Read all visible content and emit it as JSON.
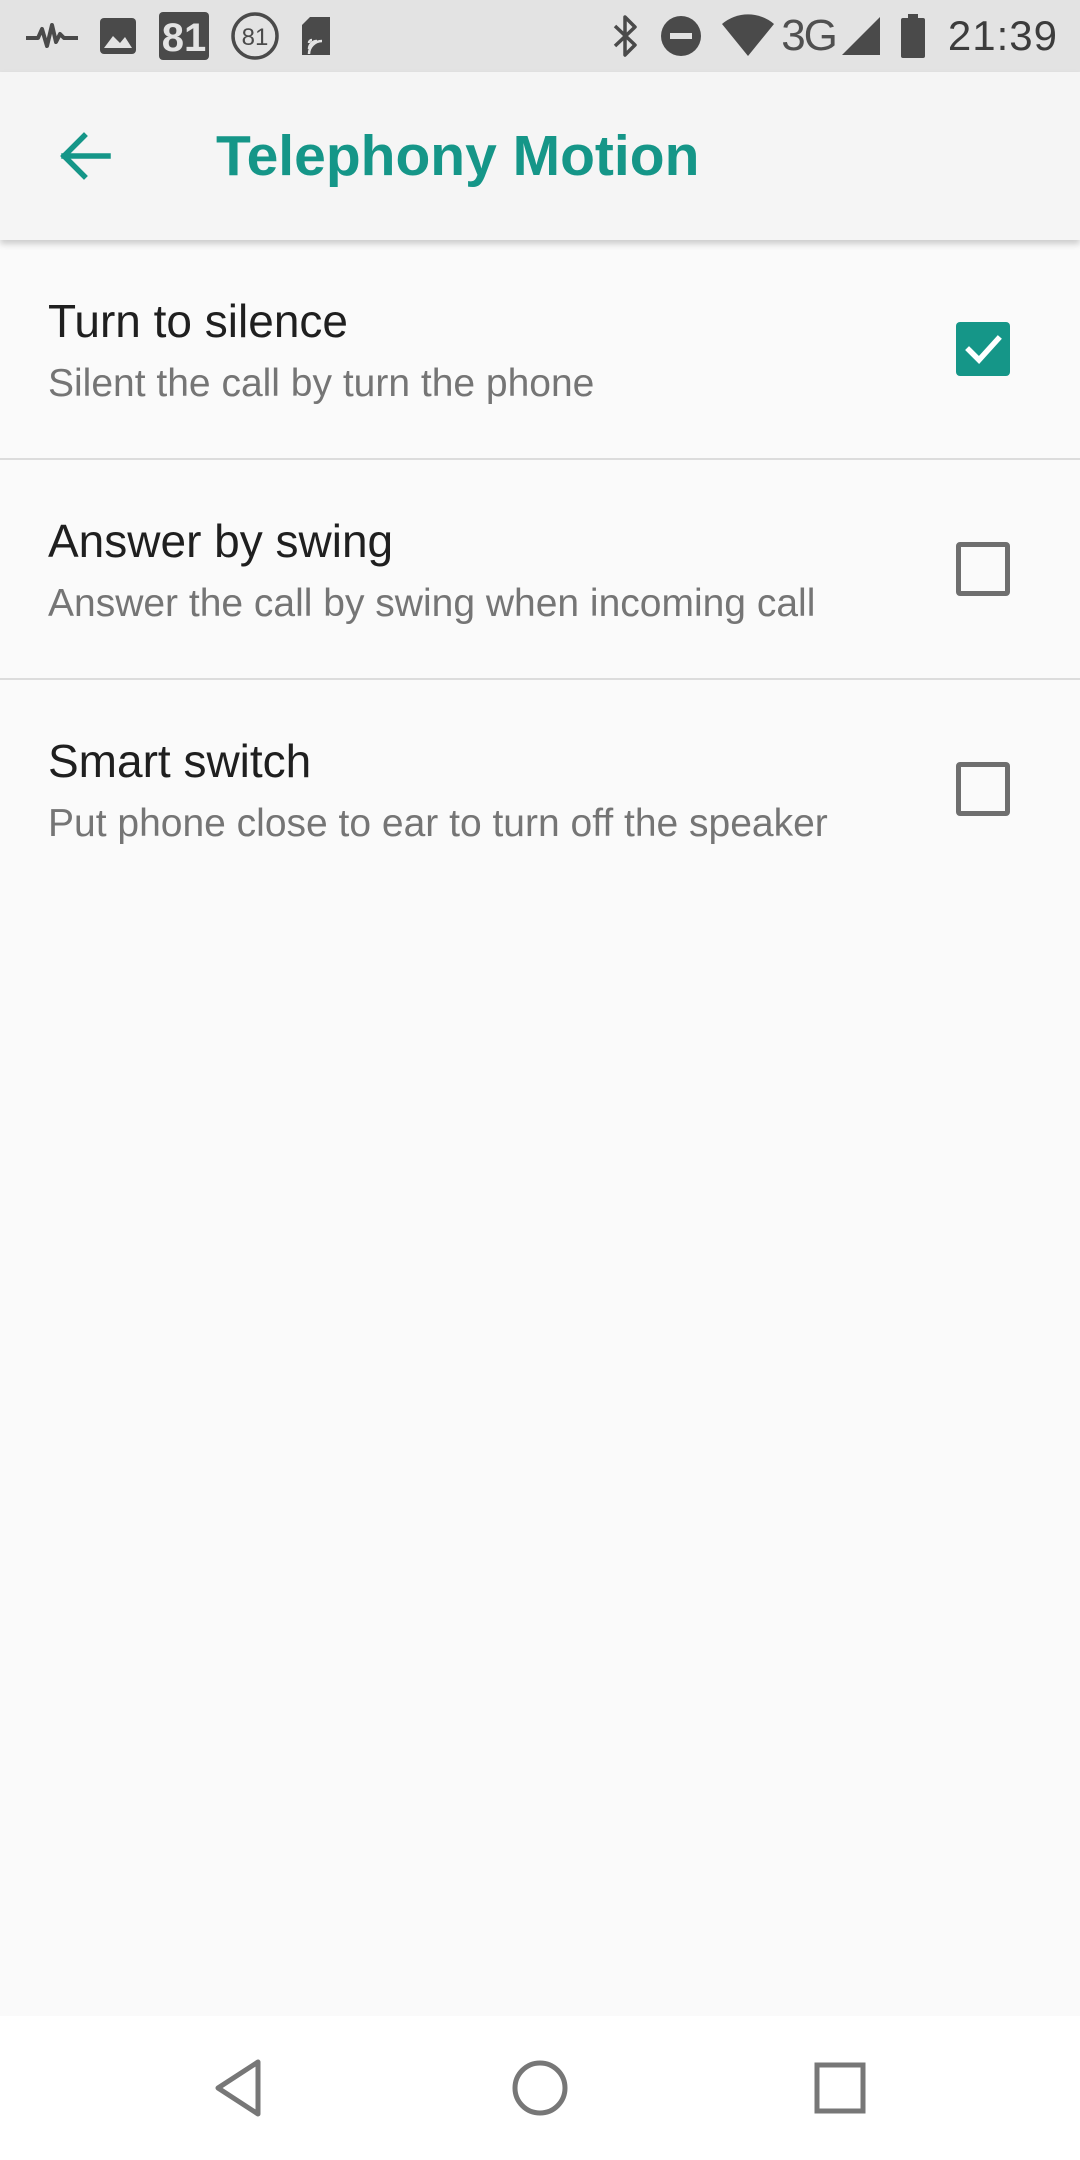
{
  "status_bar": {
    "notification_number": "81",
    "circled_number": "81",
    "network_type": "3G",
    "time": "21:39",
    "icons": [
      "activity-icon",
      "image-icon",
      "number-badge-icon",
      "circled-number-icon",
      "sd-card-icon",
      "bluetooth-icon",
      "do-not-disturb-icon",
      "wifi-icon",
      "signal-icon",
      "battery-icon"
    ]
  },
  "toolbar": {
    "title": "Telephony Motion",
    "back_icon": "arrow-back-icon"
  },
  "preferences": [
    {
      "title": "Turn to silence",
      "summary": "Silent the call by turn the phone",
      "checked": true
    },
    {
      "title": "Answer by swing",
      "summary": "Answer the call by swing when incoming call",
      "checked": false
    },
    {
      "title": "Smart switch",
      "summary": "Put phone close to ear to turn off the speaker",
      "checked": false
    }
  ],
  "nav_bar": {
    "icons": [
      "nav-back-icon",
      "nav-home-icon",
      "nav-recents-icon"
    ]
  },
  "colors": {
    "accent": "#159688",
    "status_bar_bg": "#e3e3e3",
    "toolbar_bg": "#f5f5f5",
    "background": "#fafafa",
    "title_text": "#1f1f1f",
    "summary_text": "#757575",
    "divider": "#dcdcdc"
  }
}
